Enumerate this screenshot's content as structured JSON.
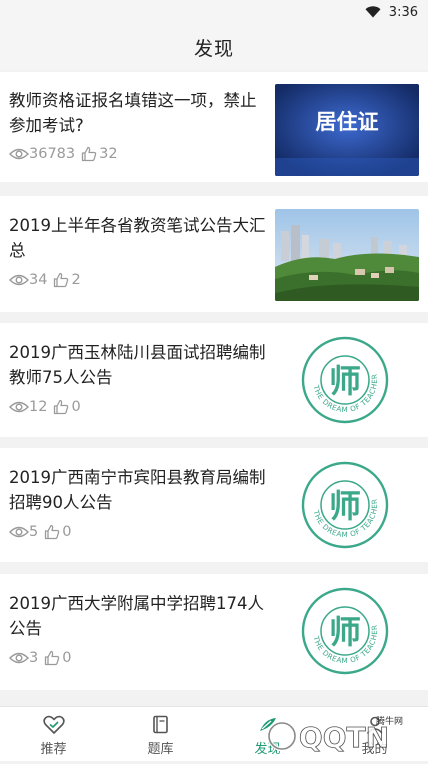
{
  "status_bar": {
    "time": "3:36"
  },
  "header": {
    "title": "发现"
  },
  "articles": [
    {
      "title": "教师资格证报名填错这一项，禁止参加考试?",
      "views": "36783",
      "likes": "32",
      "thumb_text": "居住证"
    },
    {
      "title": "2019上半年各省教资笔试公告大汇总",
      "views": "34",
      "likes": "2"
    },
    {
      "title": "2019广西玉林陆川县面试招聘编制教师75人公告",
      "views": "12",
      "likes": "0",
      "badge_char": "师",
      "badge_ring": "THE DREAM OF TEACHER"
    },
    {
      "title": "2019广西南宁市宾阳县教育局编制招聘90人公告",
      "views": "5",
      "likes": "0",
      "badge_char": "师",
      "badge_ring": "THE DREAM OF TEACHER"
    },
    {
      "title": "2019广西大学附属中学招聘174人公告",
      "views": "3",
      "likes": "0",
      "badge_char": "师",
      "badge_ring": "THE DREAM OF TEACHER"
    }
  ],
  "tabs": [
    {
      "label": "推荐",
      "icon": "heart-icon"
    },
    {
      "label": "题库",
      "icon": "book-icon"
    },
    {
      "label": "发现",
      "icon": "discover-icon"
    },
    {
      "label": "我的",
      "icon": "user-icon"
    }
  ],
  "watermark": {
    "text": "QQTN",
    "small": "腾牛网"
  },
  "colors": {
    "accent": "#1e9a74",
    "badge": "#3aa889",
    "thumb_blue": "#1f3f8c"
  }
}
